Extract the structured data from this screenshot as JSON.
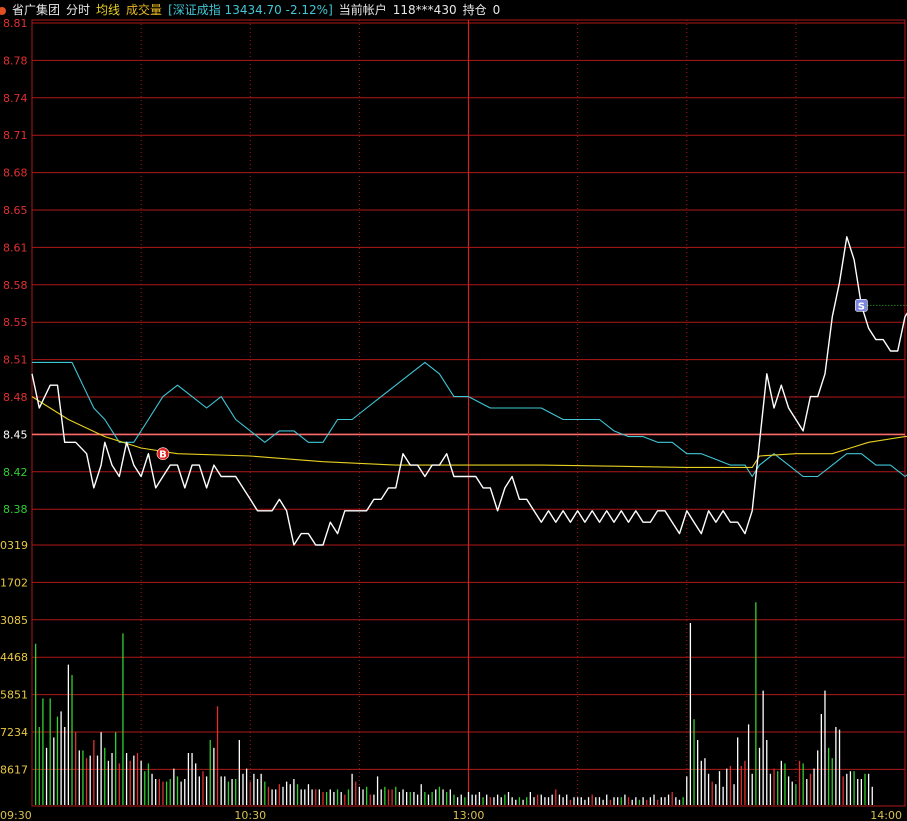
{
  "header": {
    "stock_name": "省广集团",
    "mode_label": "分时",
    "avg_label": "均线",
    "volume_label": "成交量",
    "index_text": "[深证成指 13434.70 -2.12%]",
    "account_label": "当前帐户",
    "account_value": "118***430",
    "position_label": "持仓",
    "position_value": "0"
  },
  "colors": {
    "background": "#000000",
    "grid": "#b01818",
    "price_line": "#ffffff",
    "avg_line": "#e8d020",
    "index_line": "#3fc7d6",
    "up": "#e03030",
    "down": "#30d030",
    "neutral": "#ffffff"
  },
  "chart_data": {
    "type": "line",
    "price_axis": {
      "labels": [
        "8.81",
        "8.78",
        "8.74",
        "8.71",
        "8.68",
        "8.65",
        "8.61",
        "8.58",
        "8.55",
        "8.51",
        "8.48",
        "8.45",
        "8.42",
        "8.38"
      ],
      "ref_close": "8.45",
      "ylim": [
        8.35,
        8.81
      ]
    },
    "volume_axis": {
      "labels": [
        "0319",
        "1702",
        "3085",
        "4468",
        "5851",
        "7234",
        "8617"
      ],
      "max": 10000
    },
    "x_axis": {
      "labels": [
        "09:30",
        "10:30",
        "13:00",
        "14:00"
      ],
      "total_minutes": 240
    },
    "series": [
      {
        "key": "price",
        "points": [
          [
            0,
            8.5
          ],
          [
            2,
            8.47
          ],
          [
            5,
            8.49
          ],
          [
            7,
            8.49
          ],
          [
            9,
            8.44
          ],
          [
            12,
            8.44
          ],
          [
            15,
            8.43
          ],
          [
            17,
            8.4
          ],
          [
            19,
            8.42
          ],
          [
            20,
            8.44
          ],
          [
            22,
            8.42
          ],
          [
            24,
            8.41
          ],
          [
            26,
            8.44
          ],
          [
            28,
            8.42
          ],
          [
            30,
            8.41
          ],
          [
            32,
            8.43
          ],
          [
            34,
            8.4
          ],
          [
            36,
            8.41
          ],
          [
            38,
            8.42
          ],
          [
            40,
            8.42
          ],
          [
            42,
            8.4
          ],
          [
            44,
            8.42
          ],
          [
            46,
            8.42
          ],
          [
            48,
            8.4
          ],
          [
            50,
            8.42
          ],
          [
            52,
            8.41
          ],
          [
            54,
            8.41
          ],
          [
            56,
            8.41
          ],
          [
            58,
            8.4
          ],
          [
            60,
            8.39
          ],
          [
            62,
            8.38
          ],
          [
            64,
            8.38
          ],
          [
            66,
            8.38
          ],
          [
            68,
            8.39
          ],
          [
            70,
            8.38
          ],
          [
            72,
            8.35
          ],
          [
            74,
            8.36
          ],
          [
            76,
            8.36
          ],
          [
            78,
            8.35
          ],
          [
            80,
            8.35
          ],
          [
            82,
            8.37
          ],
          [
            84,
            8.36
          ],
          [
            86,
            8.38
          ],
          [
            88,
            8.38
          ],
          [
            92,
            8.38
          ],
          [
            94,
            8.39
          ],
          [
            96,
            8.39
          ],
          [
            98,
            8.4
          ],
          [
            100,
            8.4
          ],
          [
            102,
            8.43
          ],
          [
            104,
            8.42
          ],
          [
            106,
            8.42
          ],
          [
            108,
            8.41
          ],
          [
            110,
            8.42
          ],
          [
            112,
            8.42
          ],
          [
            114,
            8.43
          ],
          [
            116,
            8.41
          ],
          [
            120,
            8.41
          ],
          [
            122,
            8.41
          ],
          [
            124,
            8.4
          ],
          [
            126,
            8.4
          ],
          [
            128,
            8.38
          ],
          [
            130,
            8.4
          ],
          [
            132,
            8.41
          ],
          [
            134,
            8.39
          ],
          [
            136,
            8.39
          ],
          [
            138,
            8.38
          ],
          [
            140,
            8.37
          ],
          [
            142,
            8.38
          ],
          [
            144,
            8.37
          ],
          [
            146,
            8.38
          ],
          [
            148,
            8.37
          ],
          [
            150,
            8.38
          ],
          [
            152,
            8.37
          ],
          [
            154,
            8.38
          ],
          [
            156,
            8.37
          ],
          [
            158,
            8.38
          ],
          [
            160,
            8.37
          ],
          [
            162,
            8.38
          ],
          [
            164,
            8.37
          ],
          [
            166,
            8.38
          ],
          [
            168,
            8.37
          ],
          [
            170,
            8.37
          ],
          [
            172,
            8.38
          ],
          [
            174,
            8.38
          ],
          [
            176,
            8.37
          ],
          [
            178,
            8.36
          ],
          [
            180,
            8.38
          ],
          [
            182,
            8.37
          ],
          [
            184,
            8.36
          ],
          [
            186,
            8.38
          ],
          [
            188,
            8.37
          ],
          [
            190,
            8.38
          ],
          [
            192,
            8.37
          ],
          [
            194,
            8.37
          ],
          [
            196,
            8.36
          ],
          [
            198,
            8.38
          ],
          [
            200,
            8.44
          ],
          [
            202,
            8.5
          ],
          [
            204,
            8.47
          ],
          [
            206,
            8.49
          ],
          [
            208,
            8.47
          ],
          [
            210,
            8.46
          ],
          [
            212,
            8.45
          ],
          [
            214,
            8.48
          ],
          [
            216,
            8.48
          ],
          [
            218,
            8.5
          ],
          [
            220,
            8.55
          ],
          [
            222,
            8.58
          ],
          [
            224,
            8.62
          ],
          [
            226,
            8.6
          ],
          [
            228,
            8.56
          ],
          [
            230,
            8.54
          ],
          [
            232,
            8.53
          ],
          [
            234,
            8.53
          ],
          [
            236,
            8.52
          ],
          [
            238,
            8.52
          ],
          [
            240,
            8.55
          ],
          [
            242,
            8.56
          ],
          [
            244,
            8.56
          ],
          [
            246,
            8.6
          ],
          [
            248,
            8.6
          ],
          [
            250,
            8.58
          ],
          [
            252,
            8.6
          ],
          [
            254,
            8.58
          ],
          [
            256,
            8.57
          ],
          [
            258,
            8.57
          ],
          [
            260,
            8.56
          ],
          [
            262,
            8.56
          ]
        ]
      },
      {
        "key": "avg",
        "points": [
          [
            0,
            8.48
          ],
          [
            10,
            8.46
          ],
          [
            20,
            8.445
          ],
          [
            30,
            8.435
          ],
          [
            40,
            8.43
          ],
          [
            60,
            8.428
          ],
          [
            80,
            8.423
          ],
          [
            100,
            8.42
          ],
          [
            120,
            8.42
          ],
          [
            140,
            8.42
          ],
          [
            160,
            8.419
          ],
          [
            180,
            8.418
          ],
          [
            198,
            8.418
          ],
          [
            200,
            8.428
          ],
          [
            210,
            8.43
          ],
          [
            220,
            8.43
          ],
          [
            225,
            8.435
          ],
          [
            230,
            8.44
          ],
          [
            240,
            8.445
          ],
          [
            250,
            8.45
          ],
          [
            262,
            8.452
          ]
        ]
      },
      {
        "key": "index",
        "points": [
          [
            0,
            8.51
          ],
          [
            4,
            8.51
          ],
          [
            8,
            8.51
          ],
          [
            11,
            8.51
          ],
          [
            14,
            8.49
          ],
          [
            17,
            8.47
          ],
          [
            20,
            8.46
          ],
          [
            24,
            8.44
          ],
          [
            28,
            8.44
          ],
          [
            32,
            8.46
          ],
          [
            36,
            8.48
          ],
          [
            40,
            8.49
          ],
          [
            44,
            8.48
          ],
          [
            48,
            8.47
          ],
          [
            52,
            8.48
          ],
          [
            56,
            8.46
          ],
          [
            60,
            8.45
          ],
          [
            64,
            8.44
          ],
          [
            68,
            8.45
          ],
          [
            72,
            8.45
          ],
          [
            76,
            8.44
          ],
          [
            80,
            8.44
          ],
          [
            84,
            8.46
          ],
          [
            88,
            8.46
          ],
          [
            92,
            8.47
          ],
          [
            96,
            8.48
          ],
          [
            100,
            8.49
          ],
          [
            104,
            8.5
          ],
          [
            108,
            8.51
          ],
          [
            112,
            8.5
          ],
          [
            116,
            8.48
          ],
          [
            120,
            8.48
          ],
          [
            126,
            8.47
          ],
          [
            130,
            8.47
          ],
          [
            136,
            8.47
          ],
          [
            140,
            8.47
          ],
          [
            146,
            8.46
          ],
          [
            152,
            8.46
          ],
          [
            156,
            8.46
          ],
          [
            160,
            8.45
          ],
          [
            164,
            8.445
          ],
          [
            168,
            8.445
          ],
          [
            172,
            8.44
          ],
          [
            176,
            8.44
          ],
          [
            180,
            8.43
          ],
          [
            184,
            8.43
          ],
          [
            188,
            8.425
          ],
          [
            192,
            8.42
          ],
          [
            196,
            8.42
          ],
          [
            198,
            8.41
          ],
          [
            200,
            8.42
          ],
          [
            204,
            8.43
          ],
          [
            208,
            8.42
          ],
          [
            212,
            8.41
          ],
          [
            216,
            8.41
          ],
          [
            220,
            8.42
          ],
          [
            224,
            8.43
          ],
          [
            228,
            8.43
          ],
          [
            232,
            8.42
          ],
          [
            236,
            8.42
          ],
          [
            240,
            8.41
          ],
          [
            244,
            8.42
          ],
          [
            248,
            8.42
          ],
          [
            252,
            8.41
          ],
          [
            256,
            8.41
          ],
          [
            262,
            8.4
          ]
        ]
      }
    ],
    "volume": [
      6200,
      3000,
      4100,
      2200,
      4100,
      2600,
      3400,
      3600,
      3000,
      5400,
      5000,
      2800,
      2100,
      2100,
      1800,
      1900,
      2500,
      1900,
      2800,
      2200,
      1700,
      2000,
      2800,
      1600,
      6600,
      2000,
      1700,
      1900,
      2000,
      1700,
      1300,
      1600,
      1200,
      1000,
      1000,
      900,
      900,
      1000,
      1400,
      1100,
      900,
      1000,
      2000,
      2000,
      1600,
      1100,
      1300,
      1100,
      2500,
      2200,
      3800,
      1100,
      1100,
      900,
      1000,
      1000,
      2500,
      1200,
      1400,
      900,
      1200,
      1000,
      1200,
      900,
      700,
      600,
      600,
      800,
      700,
      900,
      800,
      1000,
      800,
      600,
      600,
      800,
      600,
      600,
      600,
      500,
      500,
      600,
      500,
      600,
      500,
      400,
      600,
      1200,
      900,
      700,
      600,
      700,
      400,
      400,
      1100,
      600,
      700,
      600,
      600,
      700,
      500,
      600,
      500,
      500,
      500,
      400,
      800,
      500,
      400,
      500,
      600,
      700,
      600,
      500,
      600,
      400,
      300,
      400,
      300,
      500,
      400,
      400,
      500,
      300,
      400,
      300,
      300,
      400,
      300,
      400,
      500,
      300,
      200,
      300,
      200,
      300,
      500,
      300,
      400,
      400,
      300,
      300,
      400,
      600,
      400,
      300,
      400,
      200,
      300,
      300,
      300,
      200,
      300,
      400,
      300,
      300,
      200,
      400,
      200,
      300,
      300,
      300,
      400,
      300,
      200,
      300,
      200,
      300,
      200,
      300,
      400,
      200,
      300,
      300,
      400,
      500,
      300,
      200,
      300,
      1100,
      7000,
      3300,
      2500,
      1700,
      1800,
      1200,
      900,
      800,
      1300,
      700,
      1400,
      1500,
      800,
      2600,
      1500,
      1700,
      3100,
      1200,
      7800,
      2200,
      4400,
      2500,
      1200,
      1400,
      1300,
      1700,
      1600,
      1100,
      900,
      800,
      1700,
      1600,
      1000,
      1200,
      1400,
      2100,
      3500,
      4400,
      2200,
      1800,
      3000,
      2900,
      1100,
      1200,
      1300,
      1300,
      1000,
      1000,
      1200,
      1200,
      700
    ],
    "volume_dir": "gggwgwgwwwgrwgrwrwwgwwgrgwrwrwggwwrrggwgwwwwwwrwgwrwwgwgwwwrwwwgrwwrwwwwgwwwwrwrgwwgwrgwrwwgrwwwgrrgwwwgwwwgwgwgwgwgwwgwwwwgwrwwwgwwwgwgwwrwwwwrwwwrwwwwwrwwwwrwwgwrwwgwrwwrwwwrwwgwwgwwwwrwwwwrwwrrwwgwwwwrgwgwwgrgwrwwwwggwwrwwgwwgwwgrwrwwwwgwwgrgwwwwwwgw",
    "markers": [
      {
        "label": "B",
        "t": 36,
        "price": 8.43,
        "color": "#e02020"
      },
      {
        "label": "S",
        "t": 228,
        "price": 8.56,
        "color": "#7a86e0"
      }
    ],
    "sell_guide_price": 8.56
  }
}
